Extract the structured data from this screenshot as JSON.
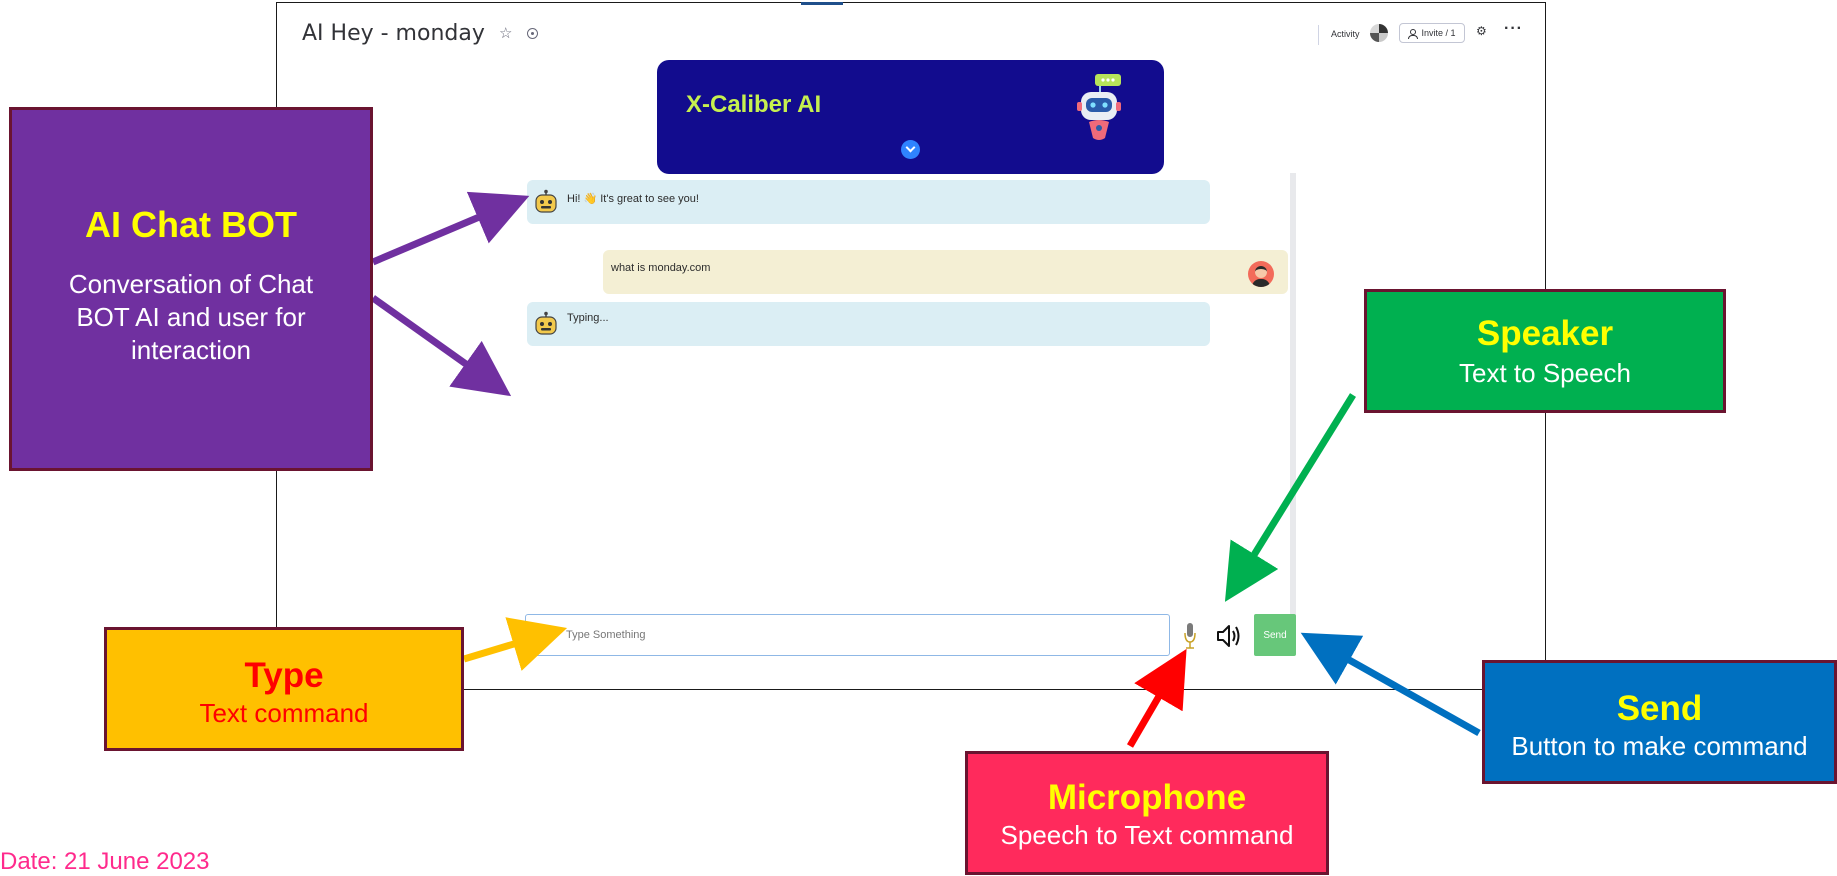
{
  "app": {
    "board_title": "AI Hey - monday",
    "activity_label": "Activity",
    "invite_label": "Invite / 1",
    "icons": {
      "star": "star-icon",
      "info": "info-icon",
      "settings": "gear-icon",
      "more": "more-icon",
      "person": "person-icon"
    }
  },
  "chatbot": {
    "title": "X-Caliber AI",
    "title_color": "#c6f04f",
    "banner_color": "#120c8e",
    "messages": [
      {
        "sender": "bot",
        "text": "Hi! 👋 It's great to see you!"
      },
      {
        "sender": "user",
        "text": "what is monday.com"
      },
      {
        "sender": "bot",
        "text": "Typing..."
      }
    ],
    "input_placeholder": "Type Something",
    "send_label": "Send",
    "send_color": "#67c77a"
  },
  "annotations": {
    "chatbot": {
      "title": "AI Chat BOT",
      "description": "Conversation of Chat BOT AI and user for interaction",
      "color": "#7030a0"
    },
    "speaker": {
      "title": "Speaker",
      "description": "Text to Speech",
      "color": "#00b050"
    },
    "type": {
      "title": "Type",
      "description": "Text command",
      "color": "#ffc000"
    },
    "send": {
      "title": "Send",
      "description": "Button to make command",
      "color": "#0070c0"
    },
    "microphone": {
      "title": "Microphone",
      "description": "Speech to Text command",
      "color": "#ff2a5c"
    }
  },
  "footer": {
    "date_text": "Date: 21 June 2023",
    "date_color": "#ff2a8c"
  }
}
